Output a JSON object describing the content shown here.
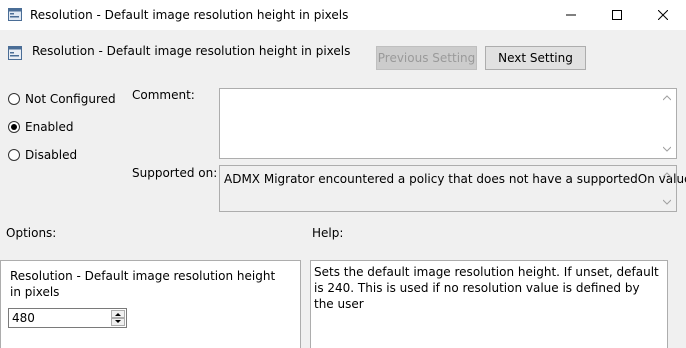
{
  "window": {
    "title": "Resolution - Default image resolution height in pixels",
    "minimize_icon": "minimize-icon",
    "maximize_icon": "maximize-icon",
    "close_icon": "close-icon"
  },
  "header": {
    "setting_title": "Resolution - Default image resolution height in pixels",
    "previous_label": "Previous Setting",
    "next_label": "Next Setting"
  },
  "state": {
    "options": [
      {
        "label": "Not Configured",
        "selected": false
      },
      {
        "label": "Enabled",
        "selected": true
      },
      {
        "label": "Disabled",
        "selected": false
      }
    ]
  },
  "comment": {
    "label": "Comment:",
    "value": ""
  },
  "supported": {
    "label": "Supported on:",
    "value": "ADMX Migrator encountered a policy that does not have a supportedOn value."
  },
  "options_section": {
    "label": "Options:",
    "field_label": "Resolution - Default image resolution height in pixels",
    "value": "480"
  },
  "help_section": {
    "label": "Help:",
    "text": "Sets the default image resolution height. If unset, default is 240. This is used if no resolution value is defined by the user"
  },
  "colors": {
    "titlebar": "#ffffff",
    "body": "#f0f0f0",
    "border": "#adadad"
  }
}
